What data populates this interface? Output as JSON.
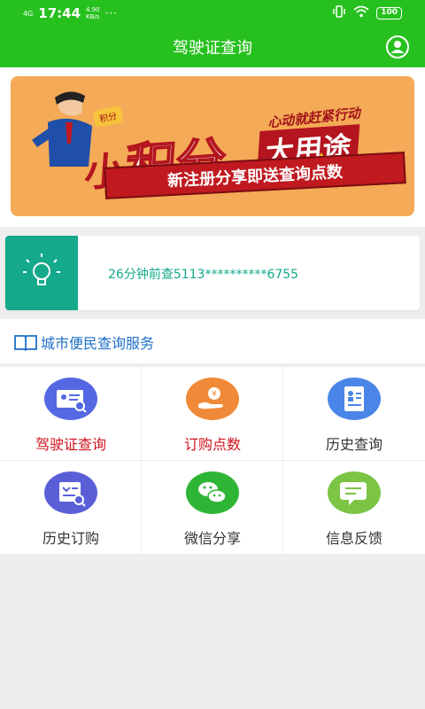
{
  "status_bar": {
    "network": "4G",
    "time": "17:44",
    "speed_value": "4.90",
    "speed_unit": "KB/s",
    "more": "···",
    "battery": "100"
  },
  "header": {
    "title": "驾驶证查询",
    "profile_icon": "user-profile-icon"
  },
  "banner": {
    "badge": "积分",
    "slogan": "心动就赶紧行动",
    "headline_small": "小",
    "headline_big": "积分",
    "headline_right": "大用途",
    "subtitle": "新注册分享即送查询点数"
  },
  "notice": {
    "icon": "lightbulb-icon",
    "text": "26分钟前查5113**********6755"
  },
  "services": {
    "title": "城市便民查询服务",
    "icon": "book-icon",
    "items": [
      {
        "label": "驾驶证查询",
        "icon": "license-search-icon",
        "color": "#5468e3",
        "highlight": true
      },
      {
        "label": "订购点数",
        "icon": "hand-coin-icon",
        "color": "#f08a38",
        "highlight": true
      },
      {
        "label": "历史查询",
        "icon": "document-person-icon",
        "color": "#4a86e8",
        "highlight": false
      },
      {
        "label": "历史订购",
        "icon": "order-search-icon",
        "color": "#5a5fd8",
        "highlight": false
      },
      {
        "label": "微信分享",
        "icon": "wechat-icon",
        "color": "#2fb536",
        "highlight": false
      },
      {
        "label": "信息反馈",
        "icon": "feedback-icon",
        "color": "#7cc444",
        "highlight": false
      }
    ]
  },
  "colors": {
    "header_green": "#27c11f",
    "notice_teal": "#13a98a",
    "link_blue": "#1e6fc5",
    "highlight_red": "#d0121b"
  }
}
